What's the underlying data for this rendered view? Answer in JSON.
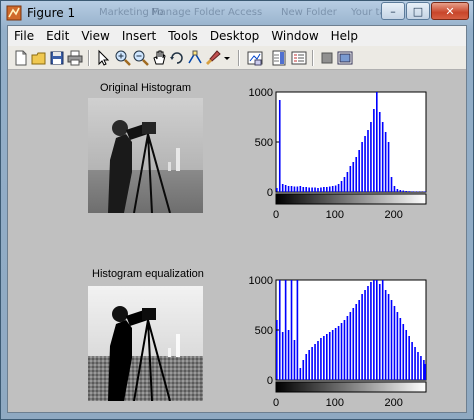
{
  "window": {
    "title": "Figure 1",
    "background_taskbar_items": [
      "Marketing Fo",
      "Manage Folder Access",
      "New Folder",
      "Your task"
    ]
  },
  "window_controls": {
    "minimize": "–",
    "maximize": "□",
    "close": "✕"
  },
  "menu": [
    "File",
    "Edit",
    "View",
    "Insert",
    "Tools",
    "Desktop",
    "Window",
    "Help"
  ],
  "toolbar_icons": [
    "new-figure-icon",
    "open-file-icon",
    "save-icon",
    "print-icon",
    "pointer-icon",
    "zoom-in-icon",
    "zoom-out-icon",
    "pan-icon",
    "rotate-3d-icon",
    "data-cursor-icon",
    "brush-icon",
    "link-plot-icon",
    "colorbar-icon",
    "legend-icon",
    "hide-plot-tools-icon",
    "show-plot-tools-icon"
  ],
  "figure": {
    "subplots": [
      {
        "title": "Original Histogram",
        "image_kind": "original"
      },
      {
        "title": "Histogram equalization",
        "image_kind": "equalized"
      }
    ]
  },
  "chart_data": [
    {
      "type": "bar",
      "color": "#0000ff",
      "xlim": [
        0,
        255
      ],
      "ylim": [
        0,
        1000
      ],
      "xticks": [
        0,
        100,
        200
      ],
      "yticks": [
        0,
        500,
        1000
      ],
      "colorbar": "grayscale",
      "x": [
        0,
        5,
        10,
        15,
        20,
        25,
        30,
        35,
        40,
        45,
        50,
        55,
        60,
        65,
        70,
        75,
        80,
        85,
        90,
        95,
        100,
        105,
        110,
        115,
        120,
        125,
        130,
        135,
        140,
        145,
        150,
        155,
        160,
        165,
        170,
        175,
        180,
        185,
        190,
        195,
        200,
        205,
        210,
        215,
        220,
        225,
        230,
        235,
        240,
        245,
        250,
        255
      ],
      "values": [
        40,
        920,
        80,
        70,
        60,
        60,
        55,
        55,
        60,
        50,
        50,
        45,
        45,
        45,
        40,
        45,
        50,
        50,
        55,
        60,
        65,
        80,
        110,
        150,
        200,
        260,
        300,
        350,
        420,
        500,
        560,
        620,
        700,
        830,
        1000,
        800,
        700,
        600,
        500,
        150,
        60,
        30,
        20,
        15,
        10,
        8,
        6,
        5,
        5,
        4,
        4,
        4
      ]
    },
    {
      "type": "bar",
      "color": "#0000ff",
      "xlim": [
        0,
        255
      ],
      "ylim": [
        0,
        1000
      ],
      "xticks": [
        0,
        100,
        200
      ],
      "yticks": [
        0,
        500,
        1000
      ],
      "colorbar": "grayscale",
      "x": [
        0,
        5,
        10,
        15,
        20,
        25,
        30,
        35,
        40,
        45,
        50,
        55,
        60,
        65,
        70,
        75,
        80,
        85,
        90,
        95,
        100,
        105,
        110,
        115,
        120,
        125,
        130,
        135,
        140,
        145,
        150,
        155,
        160,
        165,
        170,
        175,
        180,
        185,
        190,
        195,
        200,
        205,
        210,
        215,
        220,
        225,
        230,
        235,
        240,
        245,
        250,
        255
      ],
      "values": [
        600,
        1000,
        480,
        1000,
        500,
        1000,
        400,
        1000,
        120,
        200,
        260,
        300,
        330,
        360,
        390,
        420,
        440,
        460,
        480,
        500,
        520,
        540,
        570,
        600,
        640,
        680,
        720,
        760,
        800,
        860,
        900,
        940,
        980,
        1000,
        1000,
        960,
        1000,
        900,
        860,
        800,
        740,
        680,
        620,
        560,
        500,
        440,
        380,
        330,
        280,
        240,
        200,
        160
      ]
    }
  ]
}
